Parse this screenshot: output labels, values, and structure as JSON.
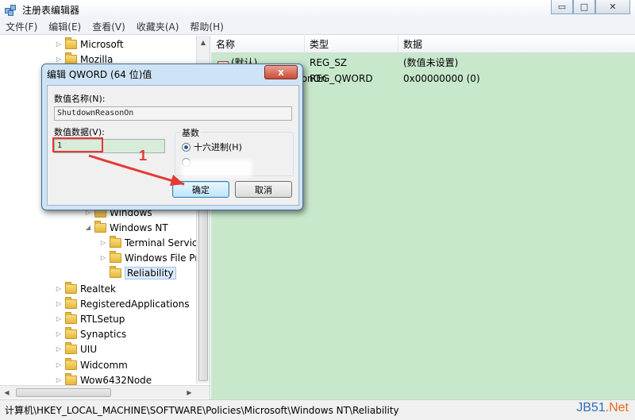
{
  "window": {
    "title": "注册表编辑器"
  },
  "titlebar_buttons": {
    "minimize": "▭",
    "maximize": "□",
    "close": "✕"
  },
  "menu": [
    "文件(F)",
    "编辑(E)",
    "查看(V)",
    "收藏夹(A)",
    "帮助(H)"
  ],
  "tree": {
    "top_items": [
      "Microsoft",
      "Mozilla"
    ],
    "windows": "Windows",
    "windows_nt": "Windows NT",
    "nt_children": [
      "Terminal Service",
      "Windows File Pr",
      "Reliability"
    ],
    "bottom_items": [
      "Realtek",
      "RegisteredApplications",
      "RTLSetup",
      "Synaptics",
      "UIU",
      "Widcomm",
      "Wow6432Node"
    ]
  },
  "columns": {
    "name": "名称",
    "type": "类型",
    "data": "数据"
  },
  "values": [
    {
      "name": "(默认)",
      "type": "REG_SZ",
      "data": "(数值未设置)"
    },
    {
      "name": "ShutdownReasonOn",
      "type": "REG_QWORD",
      "data": "0x00000000 (0)"
    }
  ],
  "dialog": {
    "title": "编辑 QWORD (64 位)值",
    "close_label": "x",
    "value_name_label": "数值名称(N):",
    "value_name": "ShutdownReasonOn",
    "value_data_label": "数值数据(V):",
    "value_data": "1",
    "base_label": "基数",
    "hex_label": "十六进制(H)",
    "ok_label": "确定",
    "cancel_label": "取消"
  },
  "annotation": {
    "step": "1"
  },
  "statusbar": {
    "path": "计算机\\HKEY_LOCAL_MACHINE\\SOFTWARE\\Policies\\Microsoft\\Windows NT\\Reliability"
  },
  "watermark": {
    "prefix": "JB51",
    "suffix": ".Net"
  }
}
